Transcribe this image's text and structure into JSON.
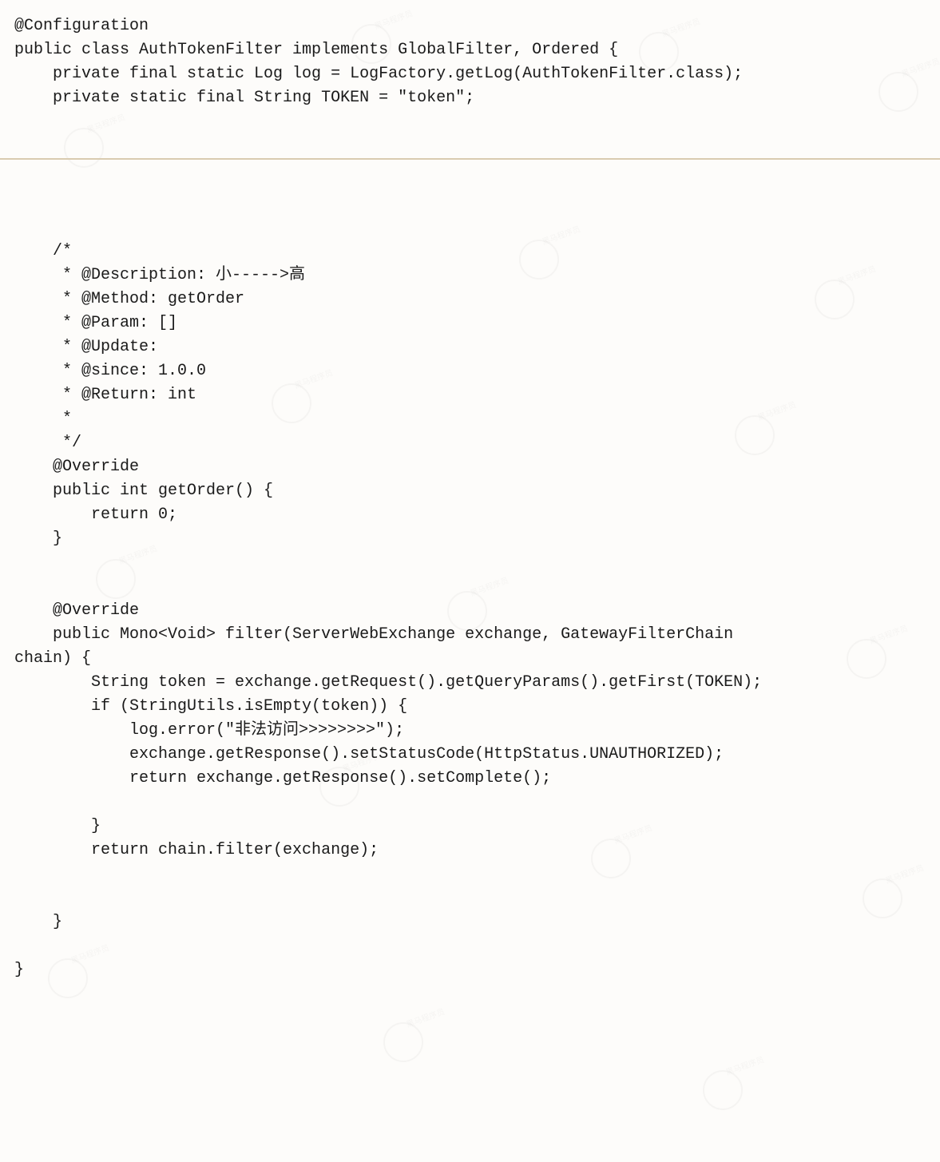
{
  "code": {
    "upper": "@Configuration\npublic class AuthTokenFilter implements GlobalFilter, Ordered {\n    private final static Log log = LogFactory.getLog(AuthTokenFilter.class);\n    private static final String TOKEN = \"token\";",
    "lower": "    /*\n     * @Description: 小----->高\n     * @Method: getOrder\n     * @Param: []\n     * @Update:\n     * @since: 1.0.0\n     * @Return: int\n     *\n     */\n    @Override\n    public int getOrder() {\n        return 0;\n    }\n\n\n    @Override\n    public Mono<Void> filter(ServerWebExchange exchange, GatewayFilterChain\nchain) {\n        String token = exchange.getRequest().getQueryParams().getFirst(TOKEN);\n        if (StringUtils.isEmpty(token)) {\n            log.error(\"非法访问>>>>>>>>\");\n            exchange.getResponse().setStatusCode(HttpStatus.UNAUTHORIZED);\n            return exchange.getResponse().setComplete();\n\n        }\n        return chain.filter(exchange);\n\n\n    }\n\n}"
  }
}
